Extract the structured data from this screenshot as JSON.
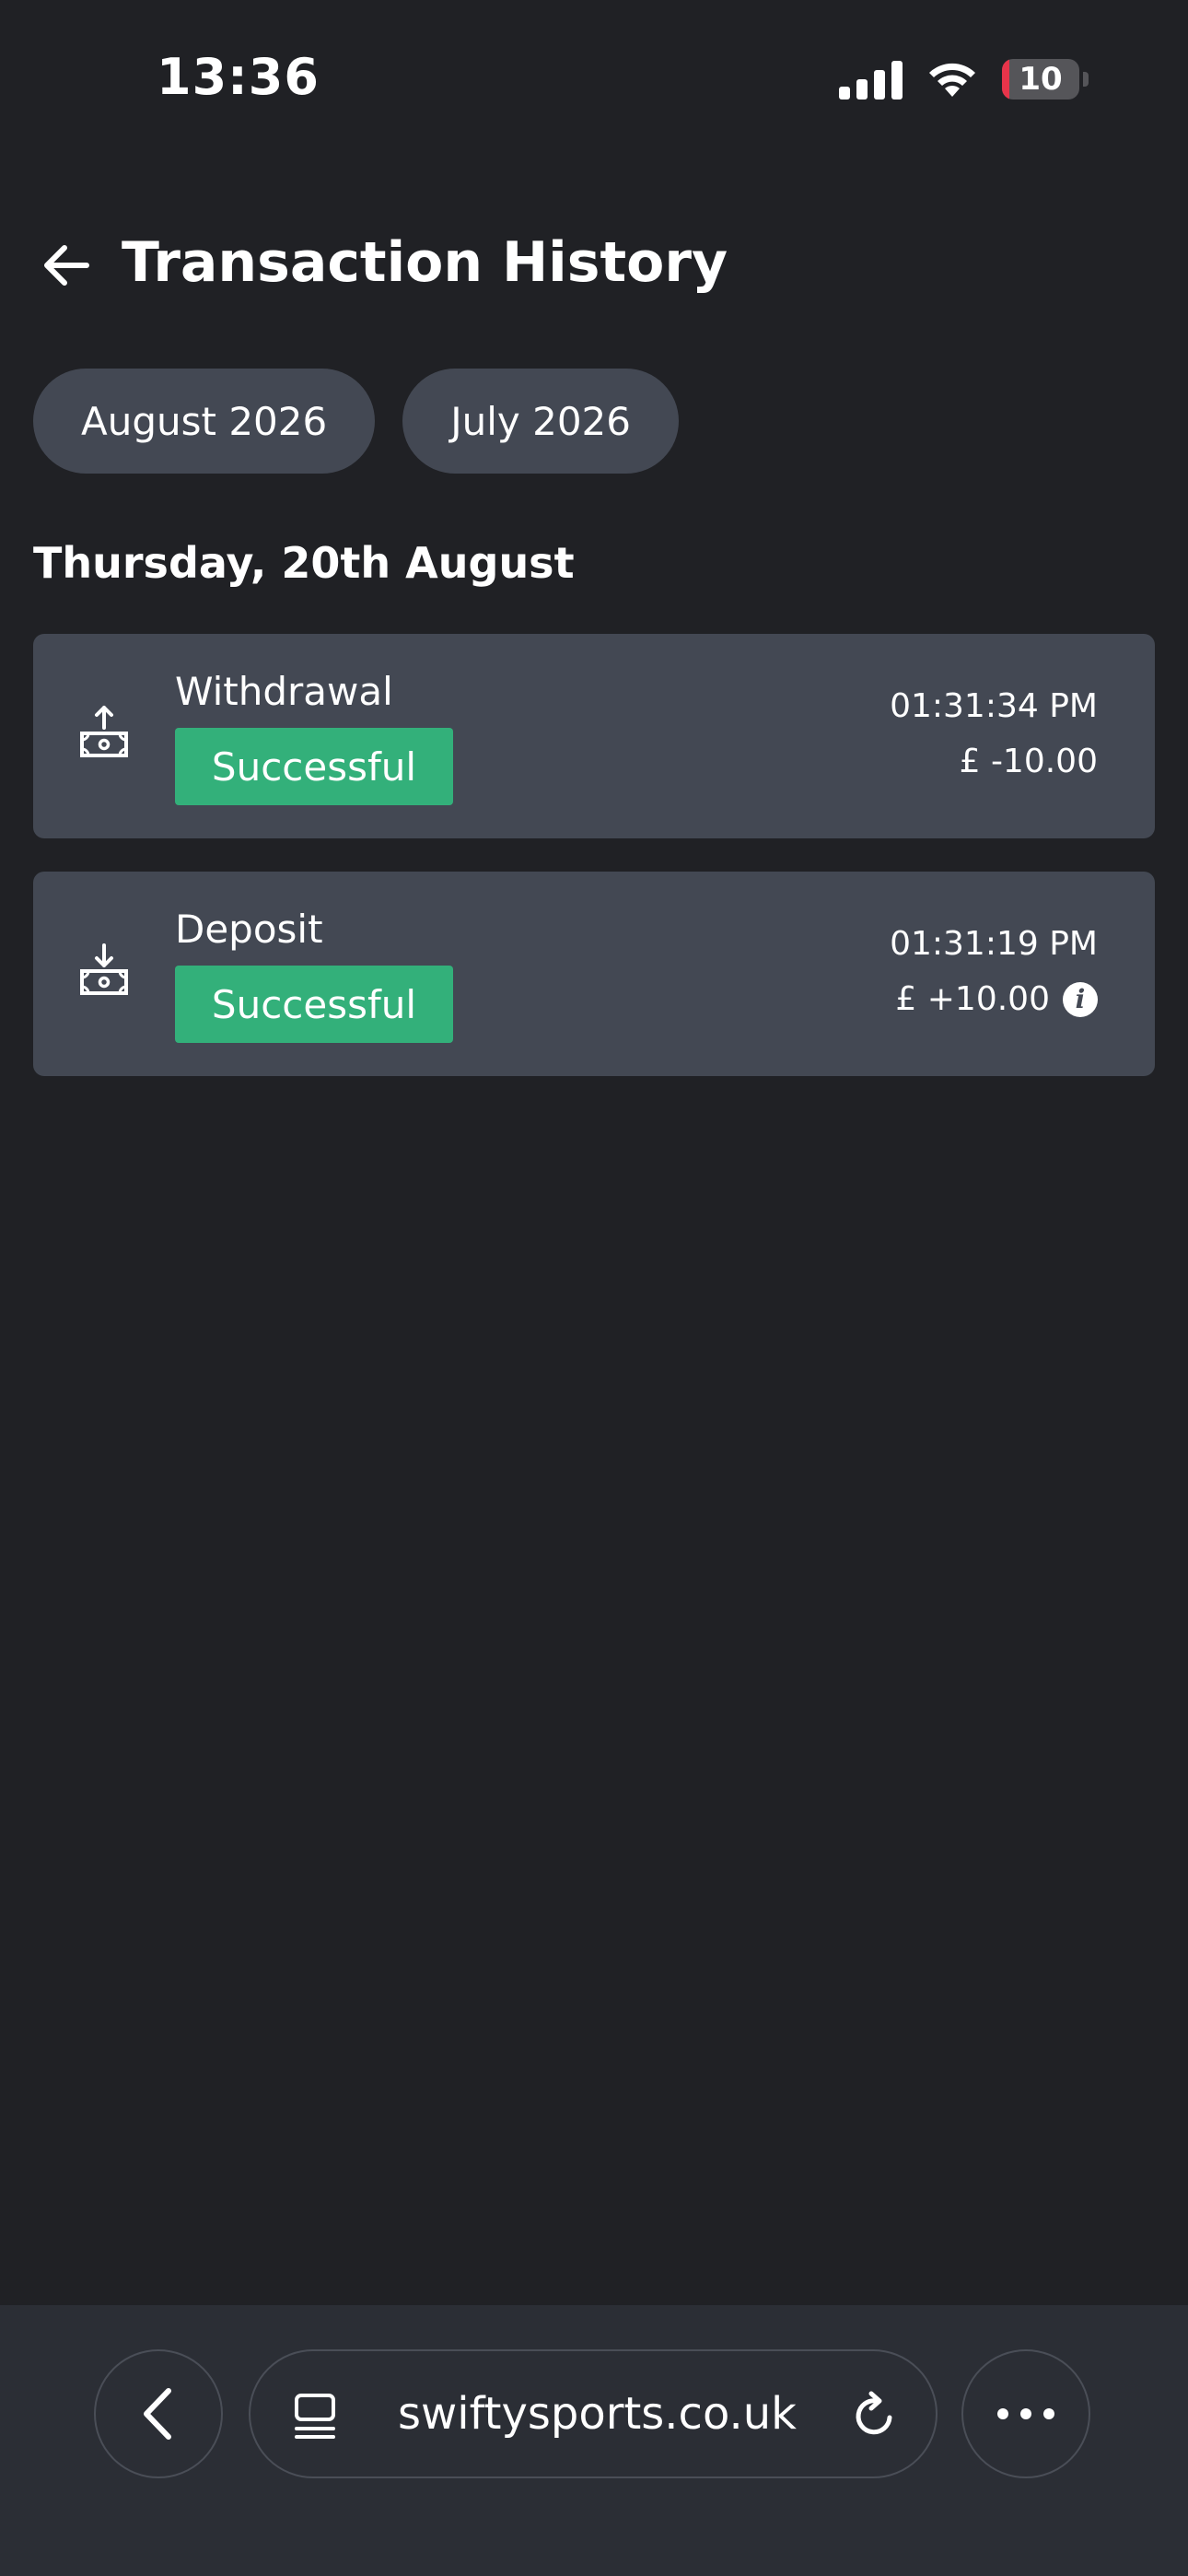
{
  "status_bar": {
    "time": "13:36",
    "battery": "10",
    "battery_fraction": 0.1,
    "battery_color": "#e8344a"
  },
  "header": {
    "title": "Transaction History"
  },
  "months": [
    {
      "label": "August 2026"
    },
    {
      "label": "July 2026"
    }
  ],
  "day_heading": "Thursday, 20th August",
  "transactions": [
    {
      "type": "Withdrawal",
      "status": "Successful",
      "time": "01:31:34 PM",
      "amount": "£ -10.00",
      "icon": "cash-withdraw-icon"
    },
    {
      "type": "Deposit",
      "status": "Successful",
      "time": "01:31:19 PM",
      "amount": "£ +10.00",
      "icon": "cash-deposit-icon"
    }
  ],
  "colors": {
    "background": "#202125",
    "card": "#434853",
    "success": "#33b07a"
  },
  "browser": {
    "url": "swiftysports.co.uk"
  }
}
